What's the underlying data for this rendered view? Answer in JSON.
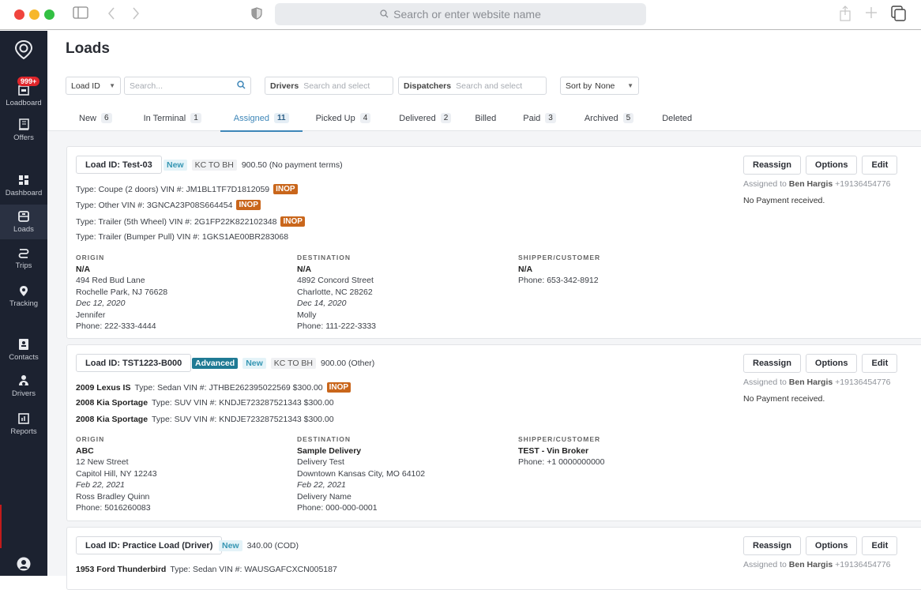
{
  "browser": {
    "url_placeholder": "Search or enter website name"
  },
  "sidebar": {
    "badge": "999+",
    "items": [
      {
        "label": "Loadboard",
        "icon": "loadboard-icon"
      },
      {
        "label": "Offers",
        "icon": "offers-icon"
      },
      {
        "label": "Dashboard",
        "icon": "dashboard-icon"
      },
      {
        "label": "Loads",
        "icon": "loads-icon",
        "active": true
      },
      {
        "label": "Trips",
        "icon": "trips-icon"
      },
      {
        "label": "Tracking",
        "icon": "tracking-icon"
      },
      {
        "label": "Contacts",
        "icon": "contacts-icon"
      },
      {
        "label": "Drivers",
        "icon": "drivers-icon"
      },
      {
        "label": "Reports",
        "icon": "reports-icon"
      }
    ]
  },
  "page": {
    "title": "Loads"
  },
  "filters": {
    "load_id_select": "Load ID",
    "search_placeholder": "Search...",
    "drivers_label": "Drivers",
    "drivers_placeholder": "Search and select",
    "dispatchers_label": "Dispatchers",
    "dispatchers_placeholder": "Search and select",
    "sort_label": "Sort by",
    "sort_value": "None"
  },
  "tabs": [
    {
      "label": "New",
      "count": "6"
    },
    {
      "label": "In Terminal",
      "count": "1"
    },
    {
      "label": "Assigned",
      "count": "11",
      "active": true
    },
    {
      "label": "Picked Up",
      "count": "4"
    },
    {
      "label": "Delivered",
      "count": "2"
    },
    {
      "label": "Billed",
      "count": ""
    },
    {
      "label": "Paid",
      "count": "3"
    },
    {
      "label": "Archived",
      "count": "5"
    },
    {
      "label": "Deleted",
      "count": ""
    }
  ],
  "actions": {
    "reassign": "Reassign",
    "options": "Options",
    "edit": "Edit"
  },
  "labels": {
    "origin": "ORIGIN",
    "destination": "DESTINATION",
    "shipper": "SHIPPER/CUSTOMER",
    "assigned_to": "Assigned to",
    "inop": "INOP"
  },
  "loads": [
    {
      "load_id": "Load ID: Test-03",
      "status": "New",
      "route": "KC TO BH",
      "price": "900.50 (No payment terms)",
      "vehicles": [
        {
          "name": "",
          "text": "Type: Coupe (2 doors)  VIN #: JM1BL1TF7D1812059",
          "inop": true
        },
        {
          "name": "",
          "text": "Type: Other  VIN #: 3GNCA23P08S664454",
          "inop": true
        },
        {
          "name": "",
          "text": "Type: Trailer (5th Wheel)  VIN #: 2G1FP22K822102348",
          "inop": true
        },
        {
          "name": "",
          "text": "Type: Trailer (Bumper Pull)  VIN #: 1GKS1AE00BR283068",
          "inop": false
        }
      ],
      "origin": {
        "name": "N/A",
        "street": "494 Red Bud Lane",
        "city": "Rochelle Park, NJ 76628",
        "date": "Dec 12, 2020",
        "contact": "Jennifer",
        "phone": "Phone: 222-333-4444"
      },
      "destination": {
        "name": "N/A",
        "street": "4892 Concord Street",
        "city": "Charlotte, NC 28262",
        "date": "Dec 14, 2020",
        "contact": "Molly",
        "phone": "Phone: 111-222-3333"
      },
      "shipper": {
        "name": "N/A",
        "phone": "Phone: 653-342-8912"
      },
      "driver": "Ben Hargis",
      "driver_phone": "+19136454776",
      "payment": "No Payment received."
    },
    {
      "load_id": "Load ID: TST1223-B000",
      "advanced": "Advanced",
      "status": "New",
      "route": "KC TO BH",
      "price": "900.00 (Other)",
      "vehicles": [
        {
          "name": "2009 Lexus IS",
          "text": "Type: Sedan  VIN #: JTHBE262395022569  $300.00",
          "inop": true
        },
        {
          "name": "2008 Kia Sportage",
          "text": "Type: SUV  VIN #: KNDJE723287521343  $300.00",
          "inop": false
        },
        {
          "name": "2008 Kia Sportage",
          "text": "Type: SUV  VIN #: KNDJE723287521343  $300.00",
          "inop": false
        }
      ],
      "origin": {
        "name": "ABC",
        "street": "12 New Street",
        "city": "Capitol Hill, NY 12243",
        "date": "Feb 22, 2021",
        "contact": "Ross Bradley Quinn",
        "phone": "Phone: 5016260083"
      },
      "destination": {
        "name": "Sample Delivery",
        "street": "Delivery Test",
        "city": "Downtown Kansas City, MO 64102",
        "date": "Feb 22, 2021",
        "contact": "Delivery Name",
        "phone": "Phone: 000-000-0001"
      },
      "shipper": {
        "name": "TEST - Vin Broker",
        "phone": "Phone: +1 0000000000"
      },
      "driver": "Ben Hargis",
      "driver_phone": "+19136454776",
      "payment": "No Payment received."
    },
    {
      "load_id": "Load ID: Practice Load (Driver)",
      "status": "New",
      "price": "340.00 (COD)",
      "vehicles": [
        {
          "name": "1953 Ford Thunderbird",
          "text": "Type: Sedan  VIN #: WAUSGAFCXCN005187",
          "inop": false
        }
      ],
      "driver": "Ben Hargis",
      "driver_phone": "+19136454776"
    }
  ]
}
